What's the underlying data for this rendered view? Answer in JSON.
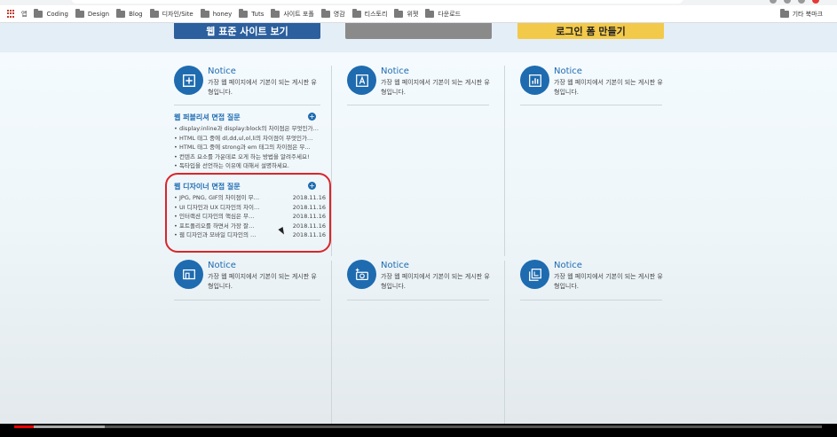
{
  "bookmarks": [
    {
      "label": "앱"
    },
    {
      "label": "Coding"
    },
    {
      "label": "Design"
    },
    {
      "label": "Blog"
    },
    {
      "label": "디자인/Site"
    },
    {
      "label": "honey"
    },
    {
      "label": "Tuts"
    },
    {
      "label": "사이트 포폴"
    },
    {
      "label": "영감"
    },
    {
      "label": "티스토리"
    },
    {
      "label": "위젯"
    },
    {
      "label": "다운로드"
    }
  ],
  "bookmarks_other": "기타 북마크",
  "top_cards": [
    "웹 표준 사이트 보기",
    "",
    "로그인 폼 만들기"
  ],
  "notices": [
    {
      "title": "Notice",
      "desc": "가장 웹 페이지에서 기본이 되는 게시판 유형입니다.",
      "icon": "plus-square-icon"
    },
    {
      "title": "Notice",
      "desc": "가장 웹 페이지에서 기본이 되는 게시판 유형입니다.",
      "icon": "text-frame-icon"
    },
    {
      "title": "Notice",
      "desc": "가장 웹 페이지에서 기본이 되는 게시판 유형입니다.",
      "icon": "bar-chart-icon"
    },
    {
      "title": "Notice",
      "desc": "가장 웹 페이지에서 기본이 되는 게시판 유형입니다.",
      "icon": "devices-icon"
    },
    {
      "title": "Notice",
      "desc": "가장 웹 페이지에서 기본이 되는 게시판 유형입니다.",
      "icon": "camera-add-icon"
    },
    {
      "title": "Notice",
      "desc": "가장 웹 페이지에서 기본이 되는 게시판 유형입니다.",
      "icon": "layers-icon"
    }
  ],
  "publisher_section": {
    "title": "웹 퍼블리셔 면접 질문",
    "items": [
      "display:inline과 display:block의 차이점은 무엇인가…",
      "HTML 태그 중에 dl,dd,ul,ol,li의 차이점이 무엇인가…",
      "HTML 태그 중에 strong과 em 태그의 차이점은 무…",
      "컨텐츠 요소를 가운데로 오게 하는 방법을 알려주세요!",
      "독타입을 선언하는 이유에 대해서 설명하세요."
    ]
  },
  "designer_section": {
    "title": "웹 디자이너 면접 질문",
    "items": [
      {
        "text": "JPG, PNG, GIF의 차이점이 무…",
        "date": "2018.11.16"
      },
      {
        "text": "UI 디자인과 UX 디자인의 차이…",
        "date": "2018.11.16"
      },
      {
        "text": "인터랙션 디자인의 핵심은 무…",
        "date": "2018.11.16"
      },
      {
        "text": "포트폴리오를 하면서 가장 잘…",
        "date": "2018.11.16"
      },
      {
        "text": "웹 디자인과 모바일 디자인의 …",
        "date": "2018.11.16"
      }
    ]
  },
  "plus_label": "+",
  "video": {
    "played_fraction": 0.024,
    "buffered_fraction": 0.112
  },
  "colors": {
    "accent": "#1e6bb0",
    "highlight": "#d9262b",
    "progress": "#ee0000"
  }
}
